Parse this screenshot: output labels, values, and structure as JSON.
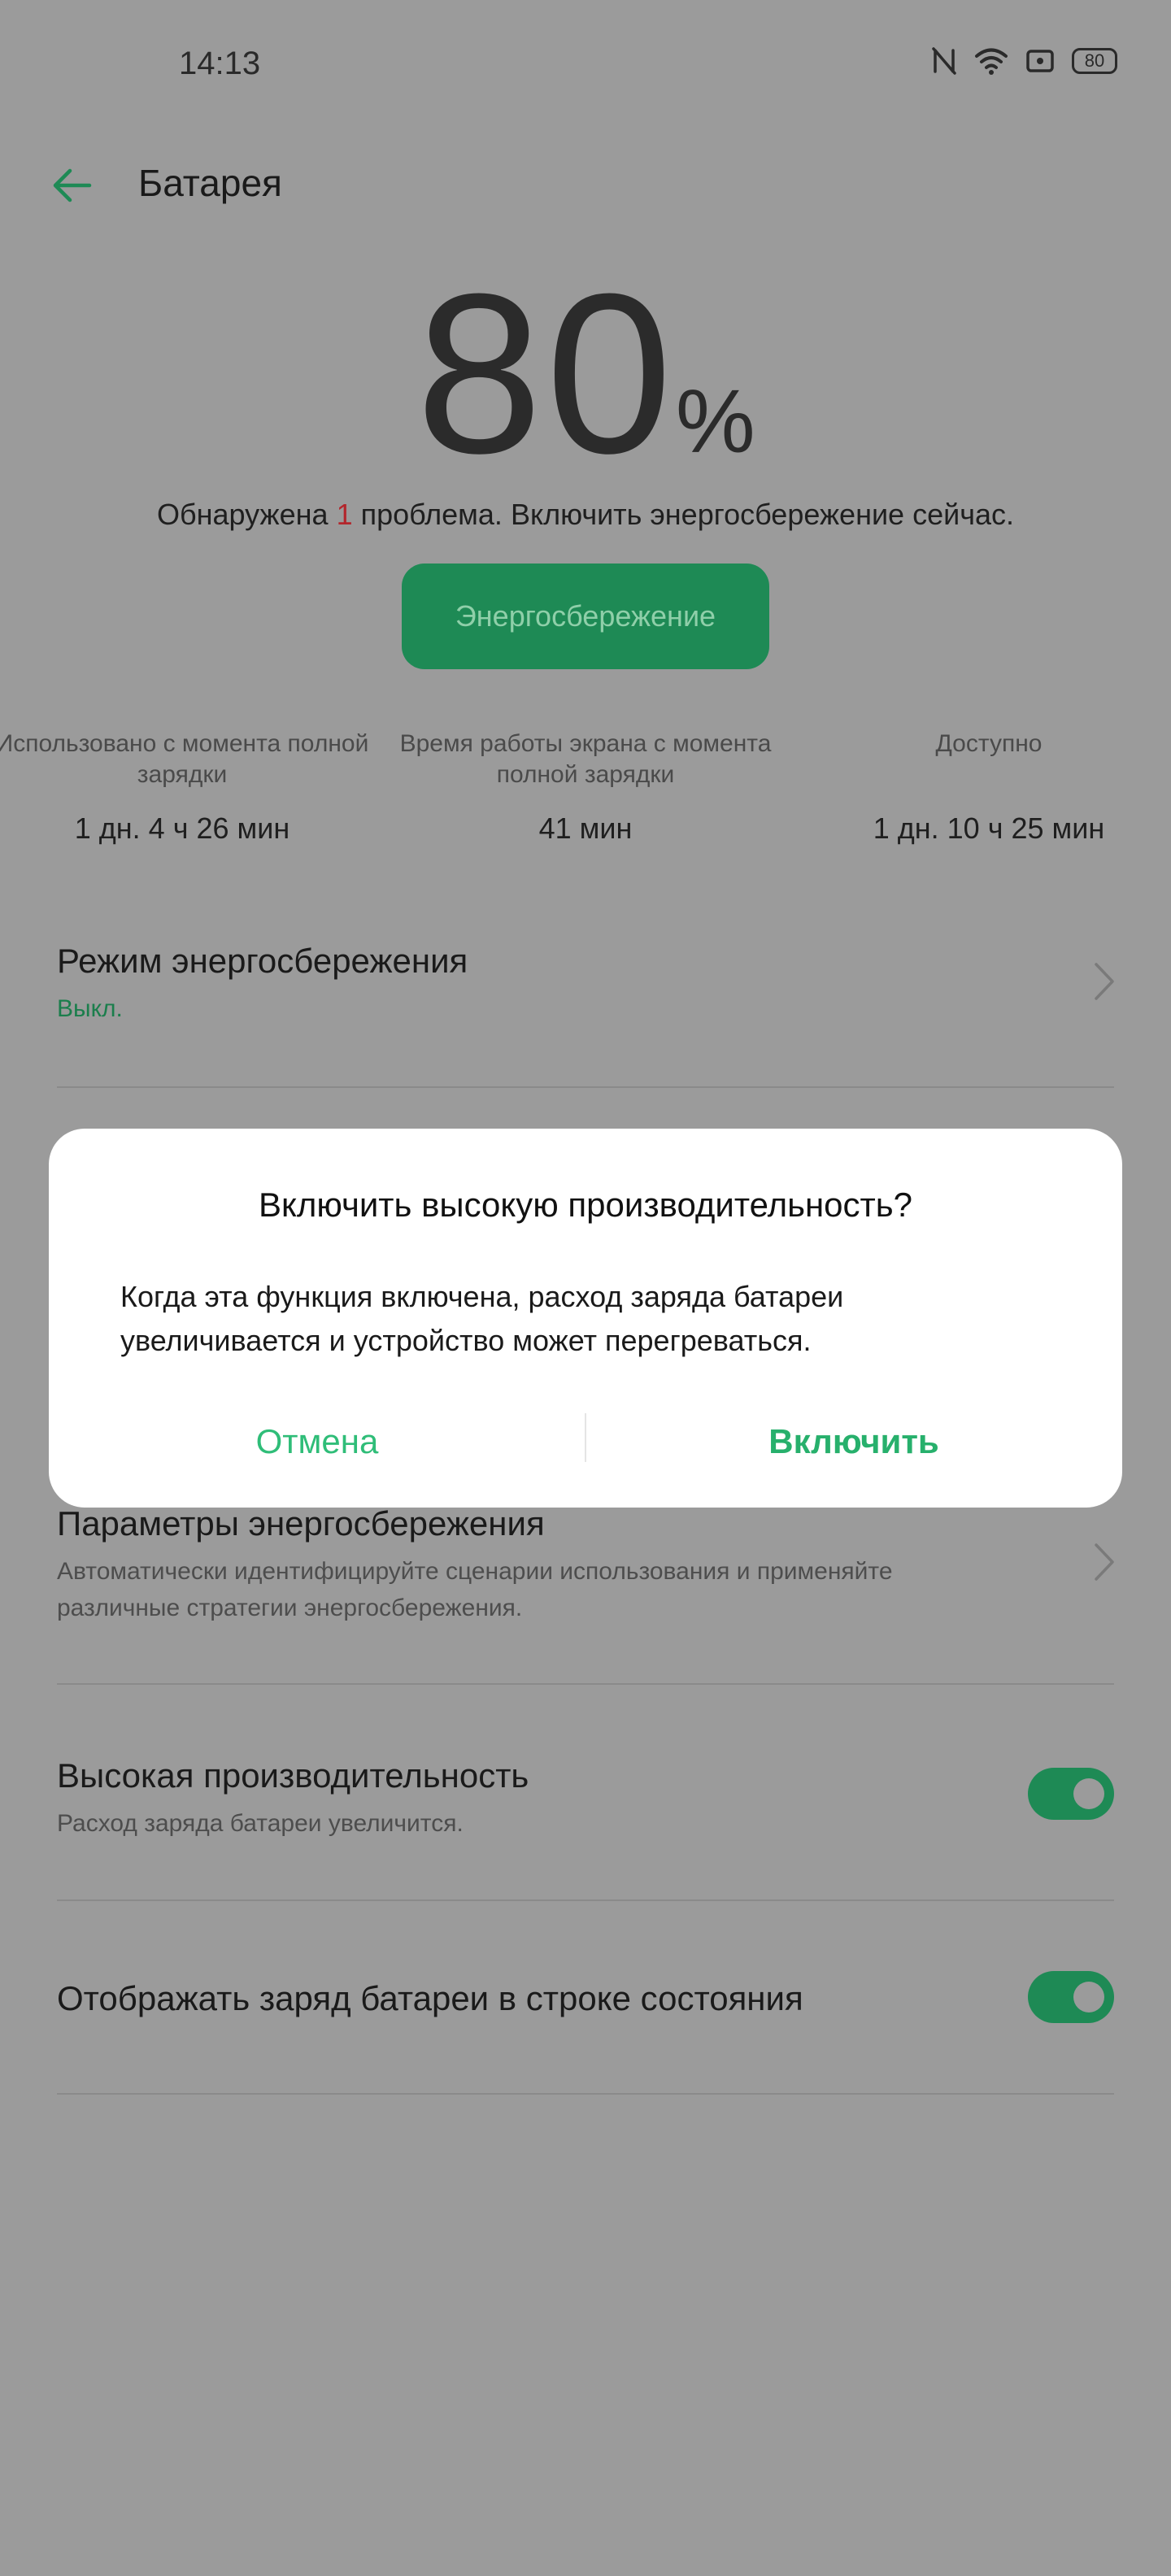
{
  "status_bar": {
    "time": "14:13",
    "battery": "80"
  },
  "header": {
    "title": "Батарея"
  },
  "battery": {
    "percent": "80",
    "percent_sign": "%",
    "problem_prefix": "Обнаружена ",
    "problem_count": "1",
    "problem_suffix": " проблема. Включить энергосбережение сейчас.",
    "saver_button": "Энергосбережение"
  },
  "stats": [
    {
      "label": "Использовано с момента полной зарядки",
      "value": "1 дн. 4 ч 26 мин"
    },
    {
      "label": "Время работы экрана с момента полной зарядки",
      "value": "41 мин"
    },
    {
      "label": "Доступно",
      "value": "1 дн. 10 ч 25 мин"
    }
  ],
  "settings": {
    "power_saving_mode": {
      "title": "Режим энергосбережения",
      "value": "Выкл."
    },
    "power_saving_params": {
      "title": "Параметры энергосбережения",
      "desc_line1": "Автоматически идентифицируйте сценарии использования и применяйте",
      "desc_line2": "различные стратегии энергосбережения."
    },
    "high_performance": {
      "title": "Высокая производительность",
      "desc": "Расход заряда батареи увеличится.",
      "enabled": true
    },
    "show_battery_status": {
      "title": "Отображать заряд батареи в строке состояния",
      "enabled": true
    }
  },
  "dialog": {
    "title": "Включить высокую производительность?",
    "message_line1": "Когда эта функция включена, расход заряда батареи",
    "message_line2": "увеличивается и устройство может перегреваться.",
    "cancel": "Отмена",
    "confirm": "Включить"
  },
  "colors": {
    "accent": "#1e8a55",
    "dialog_button": "#2fbd78",
    "scrim": "#9b9b9b",
    "problem_count": "#b3262c"
  }
}
